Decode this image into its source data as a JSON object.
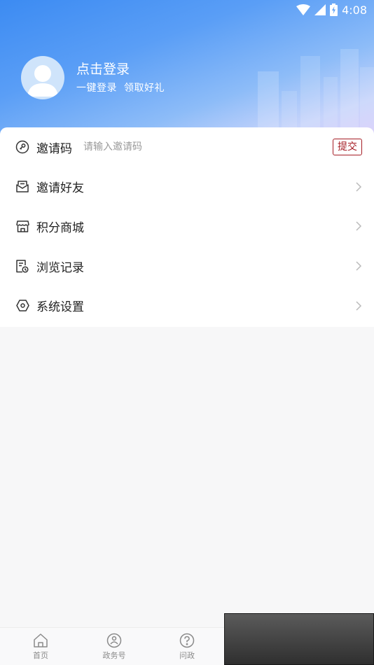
{
  "status_bar": {
    "time": "4:08"
  },
  "profile": {
    "title": "点击登录",
    "subtitle_a": "一键登录",
    "subtitle_b": "领取好礼"
  },
  "invite": {
    "label": "邀请码",
    "placeholder": "请输入邀请码",
    "submit": "提交"
  },
  "menu": [
    {
      "label": "邀请好友",
      "icon": "envelope-icon"
    },
    {
      "label": "积分商城",
      "icon": "store-icon"
    },
    {
      "label": "浏览记录",
      "icon": "history-icon"
    },
    {
      "label": "系统设置",
      "icon": "settings-icon"
    }
  ],
  "bottom_nav": [
    {
      "label": "首页",
      "icon": "home-icon"
    },
    {
      "label": "政务号",
      "icon": "government-icon"
    },
    {
      "label": "问政",
      "icon": "question-icon"
    }
  ],
  "colors": {
    "accent_red": "#a51c24",
    "header_blue": "#3c8bf2"
  }
}
